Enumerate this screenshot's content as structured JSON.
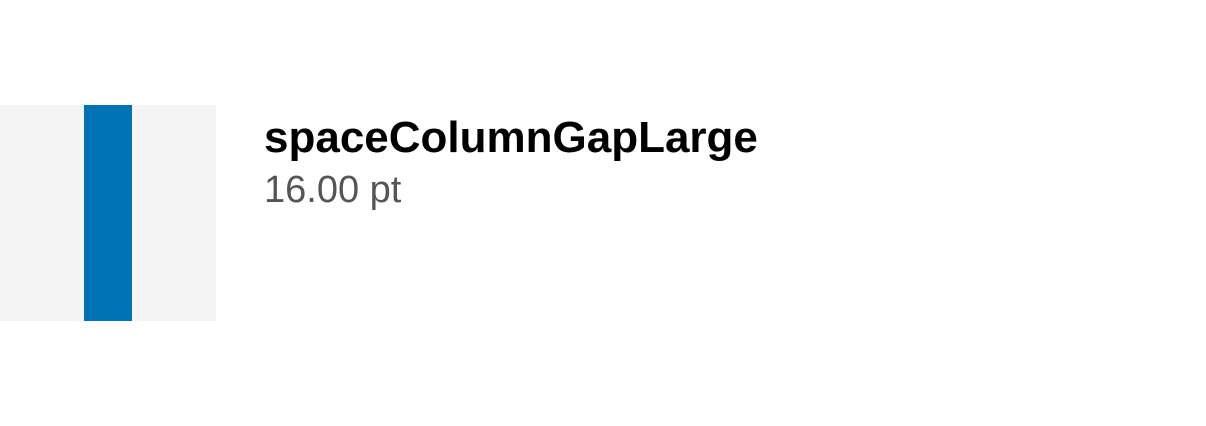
{
  "token": {
    "name": "spaceColumnGapLarge",
    "value": "16.00 pt"
  },
  "colors": {
    "swatch_background": "#f4f4f4",
    "gap_bar": "#0073b5",
    "name_text": "#000000",
    "value_text": "#555555"
  }
}
